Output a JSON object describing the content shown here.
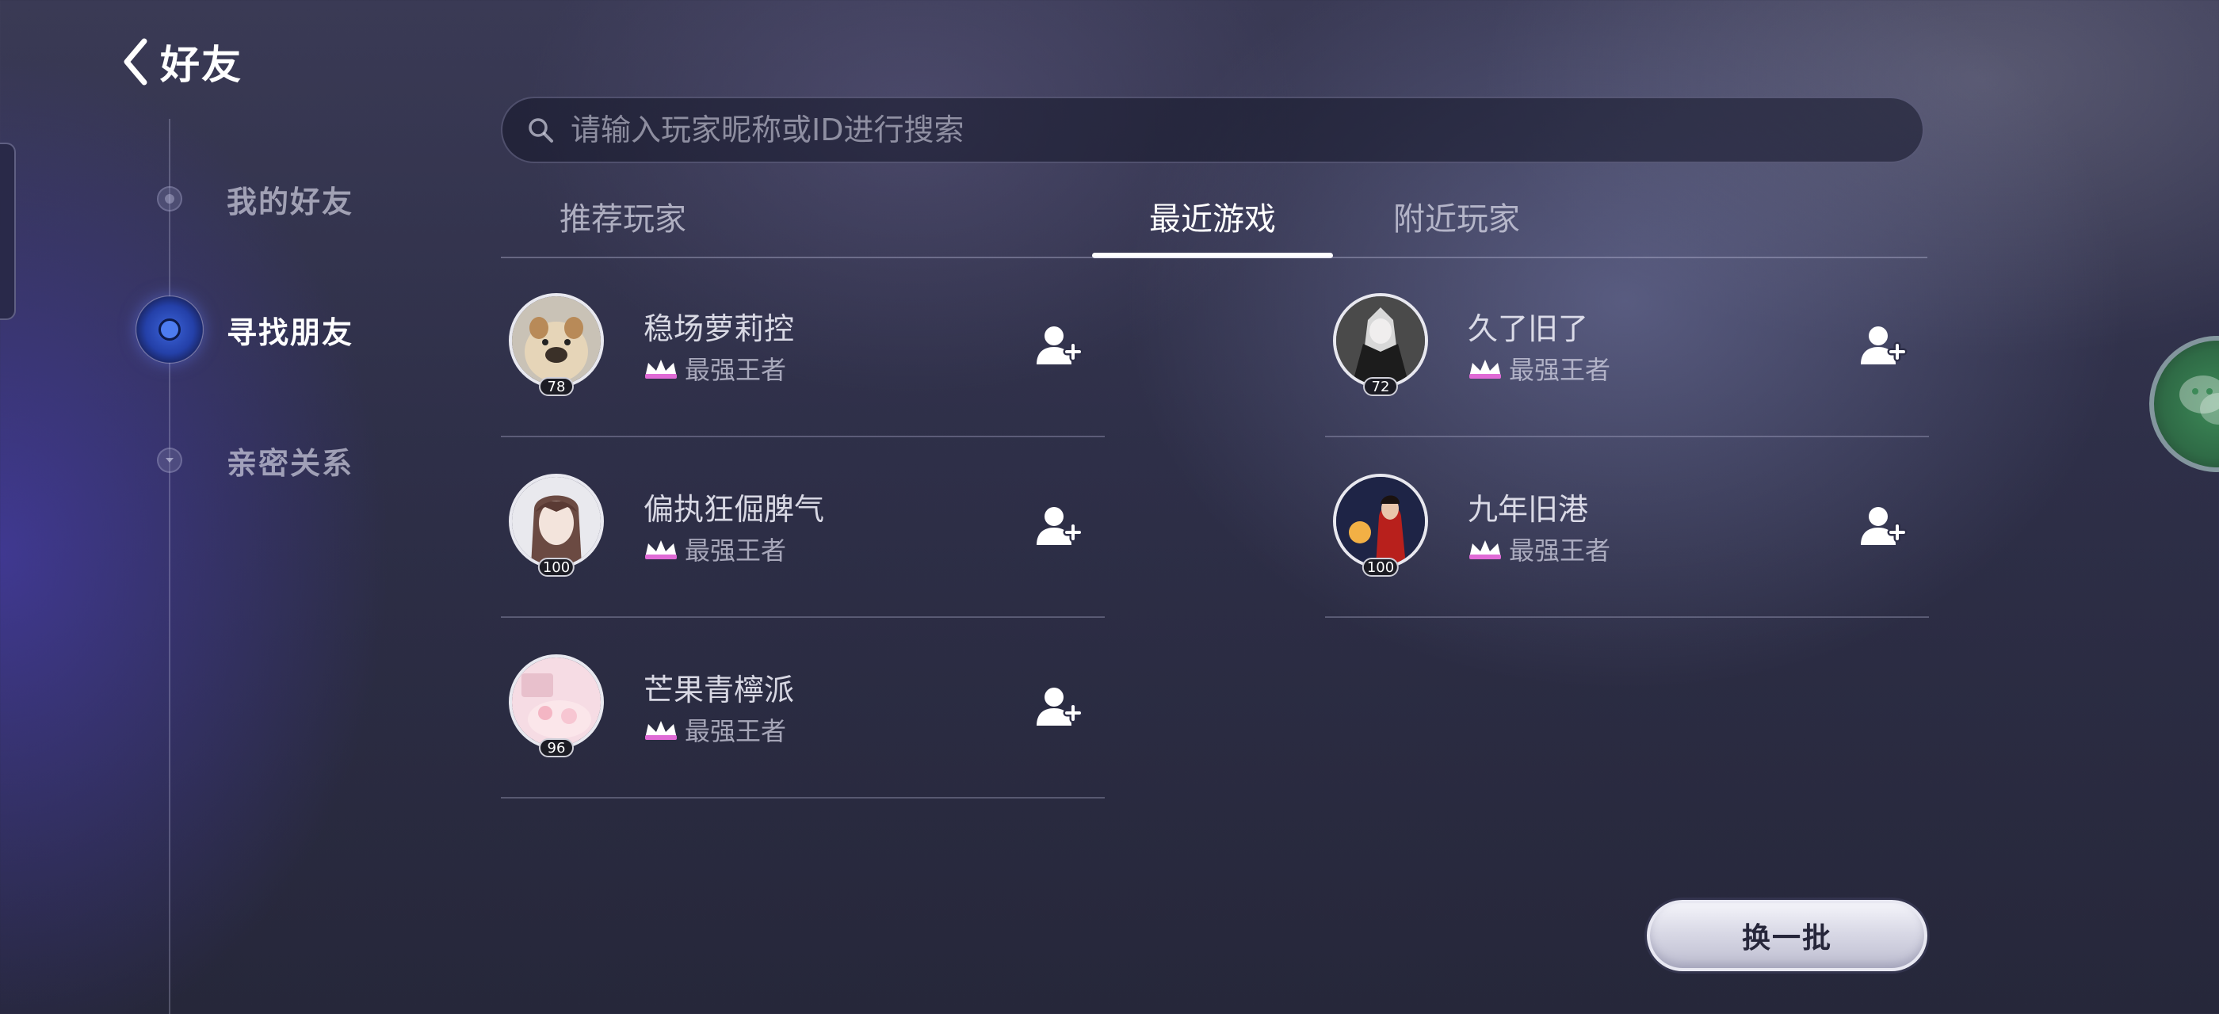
{
  "header": {
    "title": "好友"
  },
  "nav": {
    "items": [
      {
        "label": "我的好友",
        "active": false
      },
      {
        "label": "寻找朋友",
        "active": true
      },
      {
        "label": "亲密关系",
        "active": false
      }
    ]
  },
  "search": {
    "placeholder": "请输入玩家昵称或ID进行搜索"
  },
  "tabs": [
    {
      "label": "推荐玩家",
      "active": false
    },
    {
      "label": "最近游戏",
      "active": true
    },
    {
      "label": "附近玩家",
      "active": false
    }
  ],
  "players": [
    {
      "name": "稳场萝莉控",
      "level": "78",
      "rank": "最强王者"
    },
    {
      "name": "久了旧了",
      "level": "72",
      "rank": "最强王者"
    },
    {
      "name": "偏执狂倔脾气",
      "level": "100",
      "rank": "最强王者"
    },
    {
      "name": "九年旧港",
      "level": "100",
      "rank": "最强王者"
    },
    {
      "name": "芒果青檸派",
      "level": "96",
      "rank": "最强王者"
    }
  ],
  "refresh_label": "换一批",
  "colors": {
    "accent_nav": "#3b63d9",
    "rank_crown": "#e06bd6"
  }
}
